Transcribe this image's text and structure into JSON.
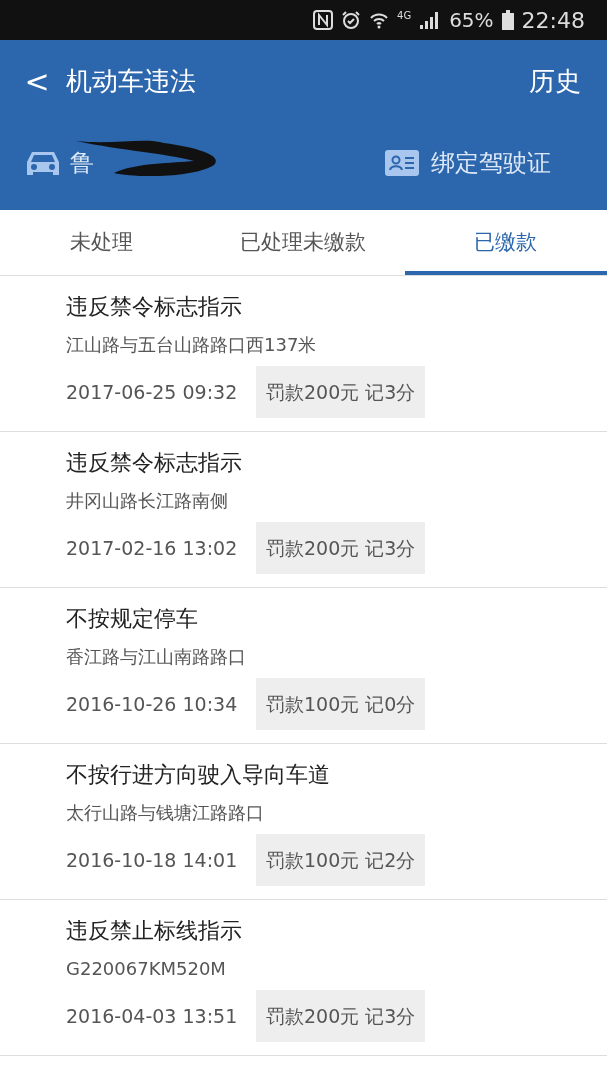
{
  "status_bar": {
    "battery": "65%",
    "time": "22:48",
    "network": "4G"
  },
  "header": {
    "back": "<",
    "title": "机动车违法",
    "history": "历史"
  },
  "vehicle": {
    "plate": "鲁",
    "bind_license": "绑定驾驶证"
  },
  "tabs": [
    {
      "label": "未处理",
      "selected": false
    },
    {
      "label": "已处理未缴款",
      "selected": false
    },
    {
      "label": "已缴款",
      "selected": true
    }
  ],
  "violations": [
    {
      "title": "违反禁令标志指示",
      "location": "江山路与五台山路路口西137米",
      "time": "2017-06-25 09:32",
      "penalty": "罚款200元 记3分"
    },
    {
      "title": "违反禁令标志指示",
      "location": "井冈山路长江路南侧",
      "time": "2017-02-16 13:02",
      "penalty": "罚款200元 记3分"
    },
    {
      "title": "不按规定停车",
      "location": "香江路与江山南路路口",
      "time": "2016-10-26 10:34",
      "penalty": "罚款100元 记0分"
    },
    {
      "title": "不按行进方向驶入导向车道",
      "location": "太行山路与钱塘江路路口",
      "time": "2016-10-18 14:01",
      "penalty": "罚款100元 记2分"
    },
    {
      "title": "违反禁止标线指示",
      "location": "G220067KM520M",
      "time": "2016-04-03 13:51",
      "penalty": "罚款200元 记3分"
    }
  ]
}
